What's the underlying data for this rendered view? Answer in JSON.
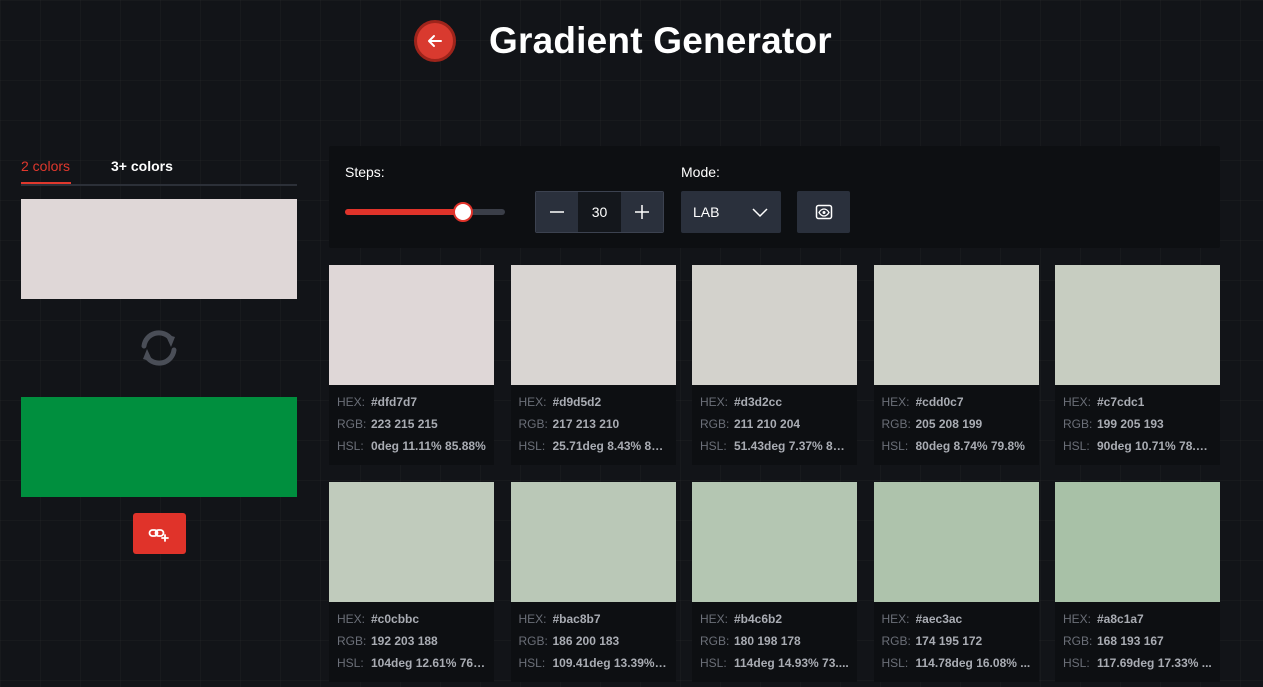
{
  "header": {
    "title": "Gradient Generator",
    "back_icon": "arrow-left-icon"
  },
  "left_panel": {
    "tabs": [
      {
        "label": "2 colors",
        "active": true
      },
      {
        "label": "3+ colors",
        "active": false
      }
    ],
    "color_start": "#dfd7d7",
    "color_end": "#008f3e",
    "swap_icon": "sync-icon",
    "link_icon": "link-add-icon"
  },
  "controls": {
    "steps_label": "Steps:",
    "steps_value": "30",
    "slider_fraction": 0.74,
    "mode_label": "Mode:",
    "mode_value": "LAB",
    "preview_icon": "eye-icon"
  },
  "labels": {
    "hex": "HEX:",
    "rgb": "RGB:",
    "hsl": "HSL:"
  },
  "accent": "#e0332a",
  "swatches": [
    {
      "hex": "#dfd7d7",
      "rgb": "223 215 215",
      "hsl": "0deg 11.11% 85.88%"
    },
    {
      "hex": "#d9d5d2",
      "rgb": "217 213 210",
      "hsl": "25.71deg 8.43% 83..."
    },
    {
      "hex": "#d3d2cc",
      "rgb": "211 210 204",
      "hsl": "51.43deg 7.37% 81..."
    },
    {
      "hex": "#cdd0c7",
      "rgb": "205 208 199",
      "hsl": "80deg 8.74% 79.8%"
    },
    {
      "hex": "#c7cdc1",
      "rgb": "199 205 193",
      "hsl": "90deg 10.71% 78.0..."
    },
    {
      "hex": "#c0cbbc",
      "rgb": "192 203 188",
      "hsl": "104deg 12.61% 76...."
    },
    {
      "hex": "#bac8b7",
      "rgb": "186 200 183",
      "hsl": "109.41deg 13.39% ..."
    },
    {
      "hex": "#b4c6b2",
      "rgb": "180 198 178",
      "hsl": "114deg 14.93% 73...."
    },
    {
      "hex": "#aec3ac",
      "rgb": "174 195 172",
      "hsl": "114.78deg 16.08% ..."
    },
    {
      "hex": "#a8c1a7",
      "rgb": "168 193 167",
      "hsl": "117.69deg 17.33% ..."
    }
  ]
}
